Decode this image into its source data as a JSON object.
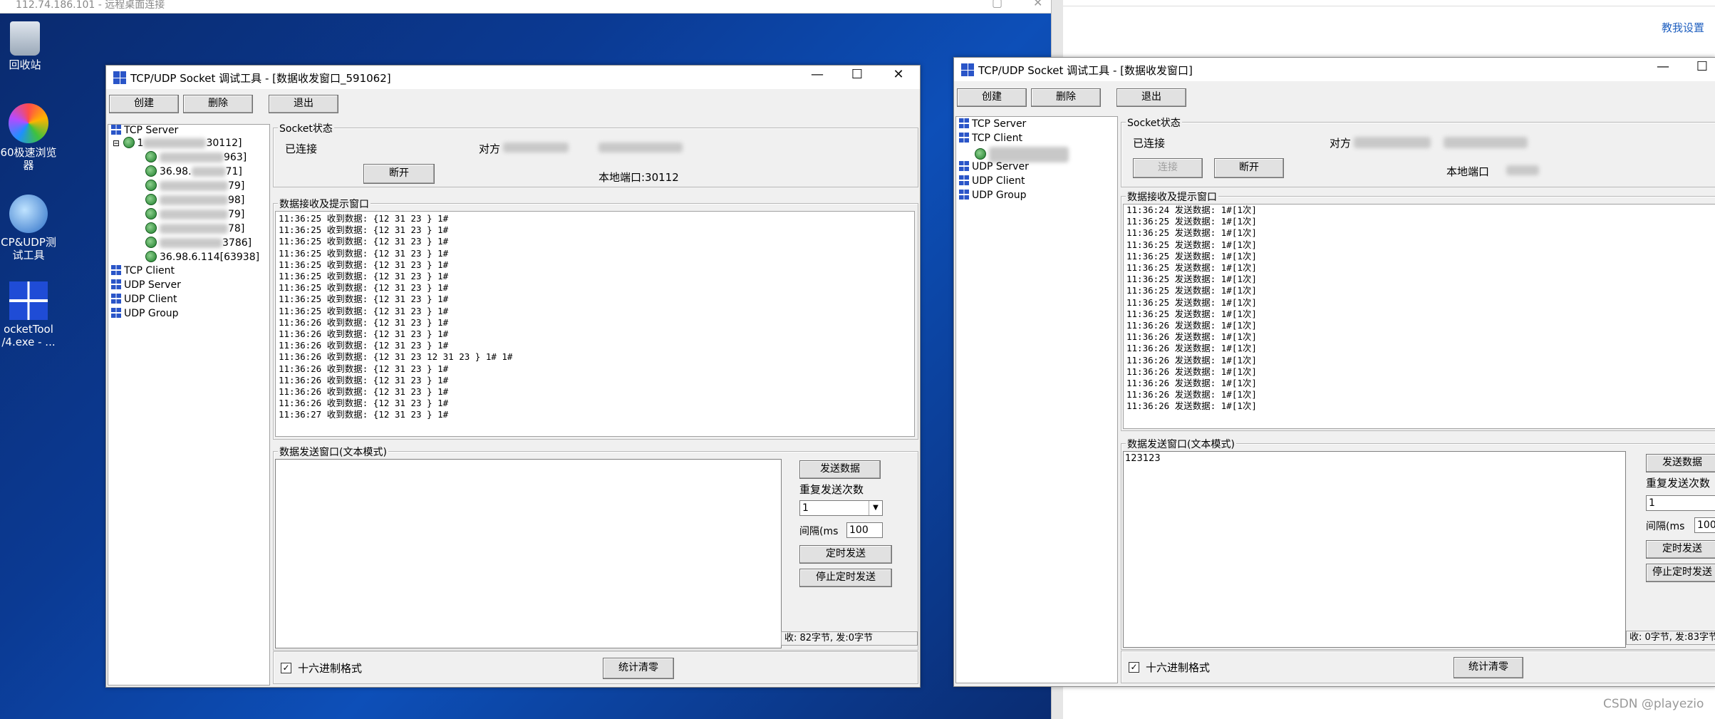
{
  "rdp": {
    "title": "112.74.186.101 - 远程桌面连接"
  },
  "browser": {
    "link": "教我设置"
  },
  "desktop_icons": [
    {
      "label": "回收站"
    },
    {
      "label": "60极速浏览\n器"
    },
    {
      "label": "CP&UDP测\n试工具"
    },
    {
      "label": "ocketTool\n/4.exe - ..."
    }
  ],
  "win1": {
    "title": "TCP/UDP Socket 调试工具 - [数据收发窗口_591062]",
    "buttons": {
      "create": "创建",
      "delete": "删除",
      "exit": "退出"
    },
    "tree": {
      "tcp_server": "TCP Server",
      "node": "1",
      "node_port": "30112]",
      "children": [
        "963]",
        "71]",
        "79]",
        "98]",
        "79]",
        "78]",
        "3786]",
        "36.98.6.114[63938]"
      ],
      "child2_prefix": "36.98.",
      "tcp_client": "TCP Client",
      "udp_server": "UDP Server",
      "udp_client": "UDP Client",
      "udp_group": "UDP Group"
    },
    "socket": {
      "legend": "Socket状态",
      "status": "已连接",
      "peer_label": "对方",
      "disconnect": "断开",
      "local_port": "本地端口:30112"
    },
    "recv": {
      "legend": "数据接收及提示窗口",
      "log": "11:36:25 收到数据: {12 31 23 } 1#\n11:36:25 收到数据: {12 31 23 } 1#\n11:36:25 收到数据: {12 31 23 } 1#\n11:36:25 收到数据: {12 31 23 } 1#\n11:36:25 收到数据: {12 31 23 } 1#\n11:36:25 收到数据: {12 31 23 } 1#\n11:36:25 收到数据: {12 31 23 } 1#\n11:36:25 收到数据: {12 31 23 } 1#\n11:36:25 收到数据: {12 31 23 } 1#\n11:36:26 收到数据: {12 31 23 } 1#\n11:36:26 收到数据: {12 31 23 } 1#\n11:36:26 收到数据: {12 31 23 } 1#\n11:36:26 收到数据: {12 31 23 12 31 23 } 1# 1#\n11:36:26 收到数据: {12 31 23 } 1#\n11:36:26 收到数据: {12 31 23 } 1#\n11:36:26 收到数据: {12 31 23 } 1#\n11:36:26 收到数据: {12 31 23 } 1#\n11:36:27 收到数据: {12 31 23 } 1#"
    },
    "send": {
      "legend": "数据发送窗口(文本模式)",
      "text": "",
      "send_btn": "发送数据",
      "repeat_label": "重复发送次数",
      "repeat_value": "1",
      "interval_label": "间隔(ms",
      "interval_value": "100",
      "timer_send": "定时发送",
      "stop_timer": "停止定时发送",
      "stats": "收: 82字节, 发:0字节"
    },
    "hex_label": "十六进制格式",
    "clear_stats": "统计清零"
  },
  "win2": {
    "title": "TCP/UDP Socket 调试工具 - [数据收发窗口]",
    "buttons": {
      "create": "创建",
      "delete": "删除",
      "exit": "退出"
    },
    "tree": {
      "tcp_server": "TCP Server",
      "tcp_client": "TCP Client",
      "udp_server": "UDP Server",
      "udp_client": "UDP Client",
      "udp_group": "UDP Group"
    },
    "socket": {
      "legend": "Socket状态",
      "status": "已连接",
      "peer_label": "对方",
      "connect": "连接",
      "disconnect": "断开",
      "local_port": "本地端口"
    },
    "recv": {
      "legend": "数据接收及提示窗口",
      "log": "11:36:24 发送数据: 1#[1次]\n11:36:25 发送数据: 1#[1次]\n11:36:25 发送数据: 1#[1次]\n11:36:25 发送数据: 1#[1次]\n11:36:25 发送数据: 1#[1次]\n11:36:25 发送数据: 1#[1次]\n11:36:25 发送数据: 1#[1次]\n11:36:25 发送数据: 1#[1次]\n11:36:25 发送数据: 1#[1次]\n11:36:25 发送数据: 1#[1次]\n11:36:26 发送数据: 1#[1次]\n11:36:26 发送数据: 1#[1次]\n11:36:26 发送数据: 1#[1次]\n11:36:26 发送数据: 1#[1次]\n11:36:26 发送数据: 1#[1次]\n11:36:26 发送数据: 1#[1次]\n11:36:26 发送数据: 1#[1次]\n11:36:26 发送数据: 1#[1次]"
    },
    "send": {
      "legend": "数据发送窗口(文本模式)",
      "text": "123123",
      "send_btn": "发送数据",
      "repeat_label": "重复发送次数",
      "repeat_value": "1",
      "interval_label": "间隔(ms",
      "interval_value": "100",
      "timer_send": "定时发送",
      "stop_timer": "停止定时发送",
      "stats": "收: 0字节, 发:83字节"
    },
    "hex_label": "十六进制格式",
    "clear_stats": "统计清零"
  },
  "watermark": "CSDN @playezio"
}
